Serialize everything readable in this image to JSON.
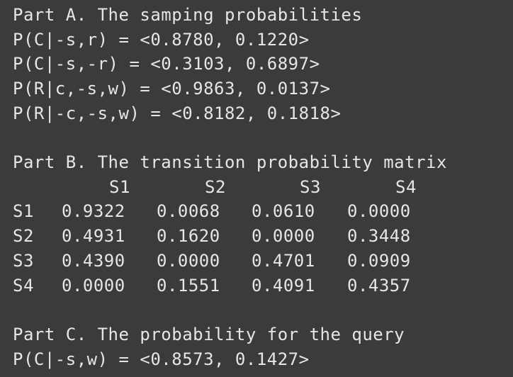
{
  "partA": {
    "title": "Part A. The samping probabilities",
    "lines": [
      "P(C|-s,r) = <0.8780, 0.1220>",
      "P(C|-s,-r) = <0.3103, 0.6897>",
      "P(R|c,-s,w) = <0.9863, 0.0137>",
      "P(R|-c,-s,w) = <0.8182, 0.1818>"
    ]
  },
  "partB": {
    "title": "Part B. The transition probability matrix",
    "headers": [
      "S1",
      "S2",
      "S3",
      "S4"
    ],
    "rows": [
      {
        "label": "S1",
        "values": [
          "0.9322",
          "0.0068",
          "0.0610",
          "0.0000"
        ]
      },
      {
        "label": "S2",
        "values": [
          "0.4931",
          "0.1620",
          "0.0000",
          "0.3448"
        ]
      },
      {
        "label": "S3",
        "values": [
          "0.4390",
          "0.0000",
          "0.4701",
          "0.0909"
        ]
      },
      {
        "label": "S4",
        "values": [
          "0.0000",
          "0.1551",
          "0.4091",
          "0.4357"
        ]
      }
    ]
  },
  "partC": {
    "title": "Part C. The probability for the query",
    "lines": [
      "P(C|-s,w) = <0.8573, 0.1427>"
    ]
  }
}
